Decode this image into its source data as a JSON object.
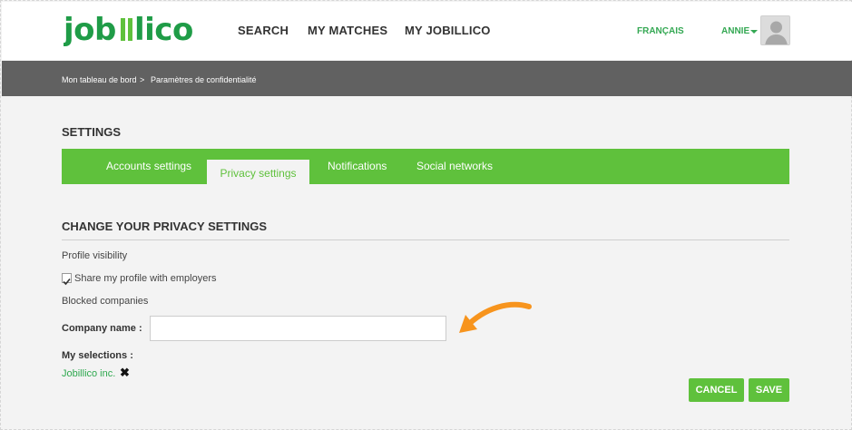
{
  "brand": {
    "logo_text": "jobillico",
    "accent": "#5fc13c",
    "logo_color": "#1f9c47"
  },
  "header": {
    "nav": [
      {
        "label": "SEARCH"
      },
      {
        "label": "MY MATCHES"
      },
      {
        "label": "MY JOBILLICO"
      }
    ],
    "language": "FRANÇAIS",
    "user": "ANNIE",
    "avatar_icon": "user-avatar-icon"
  },
  "breadcrumb": {
    "home": "Mon tableau de bord",
    "separator": ">",
    "current": "Paramètres de confidentialité"
  },
  "settings": {
    "title": "SETTINGS",
    "tabs": [
      {
        "label": "Accounts settings"
      },
      {
        "label": "Privacy settings"
      },
      {
        "label": "Notifications"
      },
      {
        "label": "Social networks"
      }
    ],
    "active_tab": "Privacy settings"
  },
  "privacy": {
    "section_title": "CHANGE YOUR PRIVACY SETTINGS",
    "profile_visibility_label": "Profile visibility",
    "share_profile_label": "Share my profile with employers",
    "share_profile_checked": true,
    "blocked_companies_label": "Blocked companies",
    "company_name_label": "Company name :",
    "company_name_value": "",
    "my_selections_label": "My selections :",
    "selections": [
      {
        "name": "Jobillico inc."
      }
    ],
    "remove_icon": "close-icon",
    "annotation_icon": "arrow-annotation-icon",
    "annotation_color": "#f7941d"
  },
  "actions": {
    "cancel_label": "CANCEL",
    "save_label": "SAVE"
  }
}
